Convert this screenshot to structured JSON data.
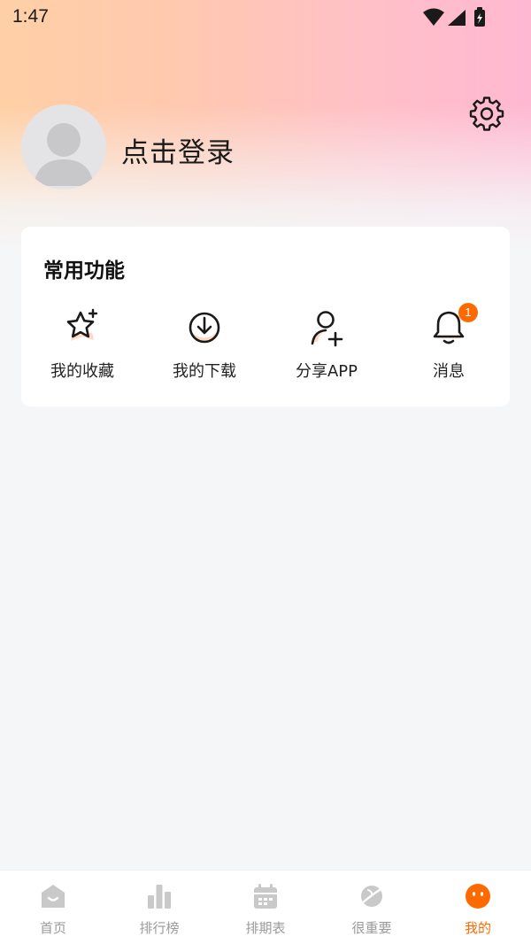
{
  "status_bar": {
    "time": "1:47",
    "icons": [
      "wifi-icon",
      "signal-icon",
      "battery-icon"
    ]
  },
  "header": {
    "login_text": "点击登录",
    "settings_icon": "gear-icon",
    "avatar_icon": "default-avatar-icon"
  },
  "functions": {
    "title": "常用功能",
    "items": [
      {
        "label": "我的收藏",
        "icon": "star-icon"
      },
      {
        "label": "我的下载",
        "icon": "download-icon"
      },
      {
        "label": "分享APP",
        "icon": "add-user-icon"
      },
      {
        "label": "消息",
        "icon": "bell-icon",
        "badge": "1"
      }
    ]
  },
  "tabbar": {
    "items": [
      {
        "label": "首页",
        "icon": "home-icon",
        "active": false
      },
      {
        "label": "排行榜",
        "icon": "bar-chart-icon",
        "active": false
      },
      {
        "label": "排期表",
        "icon": "calendar-icon",
        "active": false
      },
      {
        "label": "很重要",
        "icon": "planet-icon",
        "active": false
      },
      {
        "label": "我的",
        "icon": "face-icon",
        "active": true
      }
    ]
  },
  "colors": {
    "accent": "#ff6a00",
    "tab_inactive": "#9a9a9a",
    "tab_icon_inactive": "#c9c9c9",
    "background": "#f5f6f8",
    "card": "#ffffff"
  }
}
